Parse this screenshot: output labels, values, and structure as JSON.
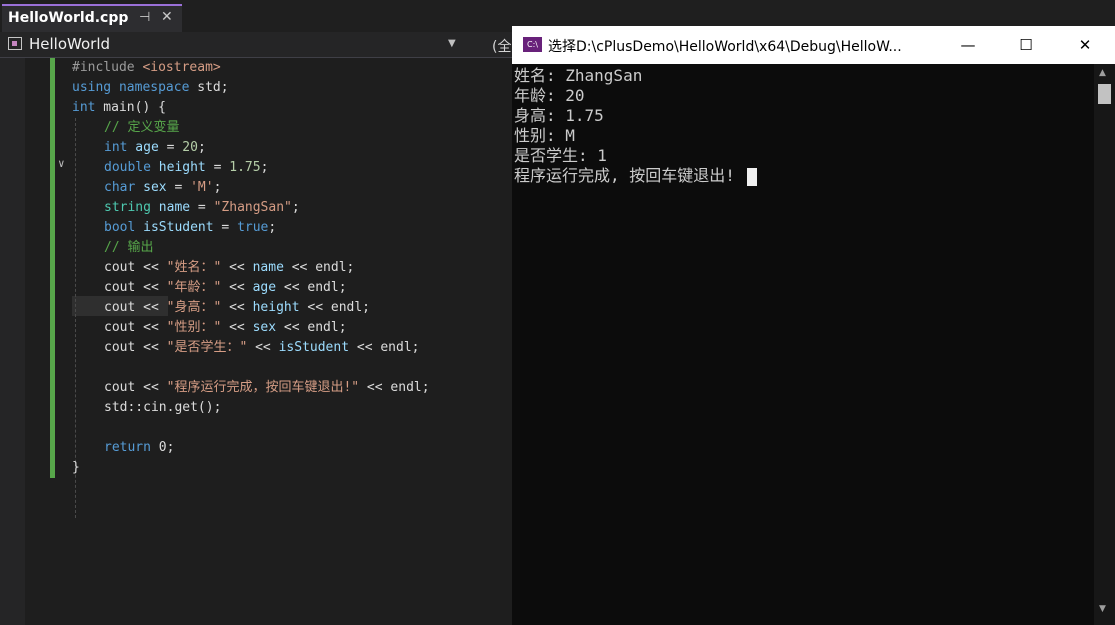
{
  "ide": {
    "tab_title": "HelloWorld.cpp",
    "tab_pin_glyph": "⊣",
    "tab_close_glyph": "✕",
    "project": "HelloWorld",
    "scope": "(全",
    "code": {
      "l1_pp": "#include ",
      "l1_inc": "<iostream>",
      "l2_kw1": "using",
      "l2_kw2": "namespace",
      "l2_rest": " std;",
      "l3_kw": "int",
      "l3_rest": " main() {",
      "l4_cm": "// 定义变量",
      "l5_kw": "int",
      "l5_var": " age",
      "l5_op": " = ",
      "l5_num": "20",
      "l5_end": ";",
      "l6_kw": "double",
      "l6_var": " height",
      "l6_op": " = ",
      "l6_num": "1.75",
      "l6_end": ";",
      "l7_kw": "char",
      "l7_var": " sex",
      "l7_op": " = ",
      "l7_str": "'M'",
      "l7_end": ";",
      "l8_ty": "string",
      "l8_var": " name",
      "l8_op": " = ",
      "l8_str": "\"ZhangSan\"",
      "l8_end": ";",
      "l9_kw": "bool",
      "l9_var": " isStudent",
      "l9_op": " = ",
      "l9_kw2": "true",
      "l9_end": ";",
      "l10_cm": "// 输出",
      "l11_a": "cout << ",
      "l11_str": "\"姓名：\"",
      "l11_b": " << ",
      "l11_var": "name",
      "l11_c": " << endl;",
      "l12_a": "cout << ",
      "l12_str": "\"年龄：\"",
      "l12_b": " << ",
      "l12_var": "age",
      "l12_c": " << endl;",
      "l13_a": "cout << ",
      "l13_str": "\"身高：\"",
      "l13_b": " << ",
      "l13_var": "height",
      "l13_c": " << endl;",
      "l14_a": "cout << ",
      "l14_str": "\"性别：\"",
      "l14_b": " << ",
      "l14_var": "sex",
      "l14_c": " << endl;",
      "l15_a": "cout << ",
      "l15_str": "\"是否学生：\"",
      "l15_b": " << ",
      "l15_var": "isStudent",
      "l15_c": " << endl;",
      "l17_a": "cout << ",
      "l17_str": "\"程序运行完成，按回车键退出!\"",
      "l17_c": " << endl;",
      "l18": "std::cin.get();",
      "l20_kw": "return",
      "l20_rest": " 0;",
      "l21": "}"
    }
  },
  "console": {
    "title": "选择D:\\cPlusDemo\\HelloWorld\\x64\\Debug\\HelloW...",
    "app_icon_label": "C:\\",
    "minimize_glyph": "—",
    "maximize_glyph": "☐",
    "close_glyph": "✕",
    "lines": [
      "姓名: ZhangSan",
      "年龄: 20",
      "身高: 1.75",
      "性别: M",
      "是否学生: 1",
      "程序运行完成, 按回车键退出!"
    ]
  },
  "colors": {
    "ide_bg": "#1e1e1e",
    "tab_accent": "#9a70d8",
    "change_bar": "#57a64a",
    "console_bg": "#0c0c0c"
  }
}
